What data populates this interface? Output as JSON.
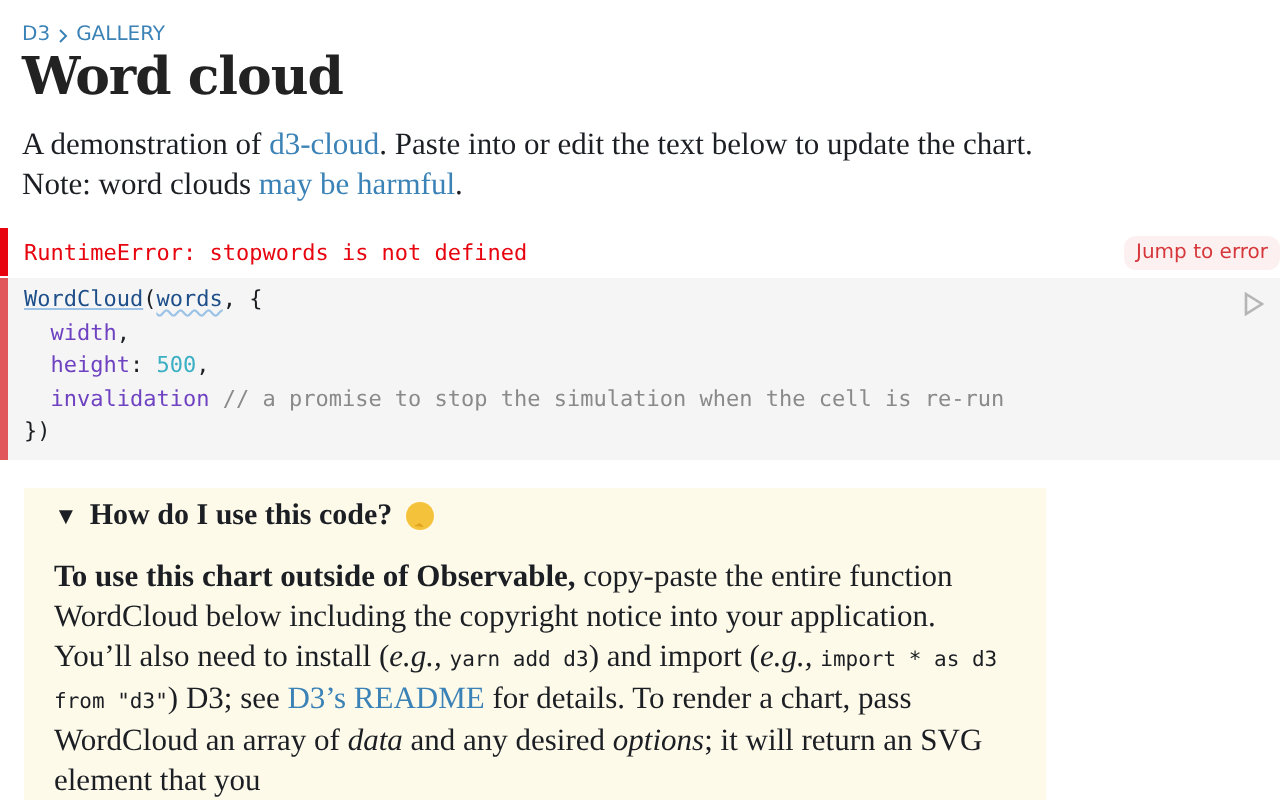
{
  "breadcrumb": [
    "D3",
    "GALLERY"
  ],
  "title": "Word cloud",
  "intro": [
    [
      {
        "kind": "text",
        "text": "A demonstration of "
      },
      {
        "kind": "link",
        "text": "d3-cloud"
      },
      {
        "kind": "text",
        "text": ". Paste into or edit the text below to update the chart."
      }
    ],
    [
      {
        "kind": "text",
        "text": "Note: word clouds "
      },
      {
        "kind": "link",
        "text": "may be harmful"
      },
      {
        "kind": "text",
        "text": "."
      }
    ]
  ],
  "error": {
    "message": "RuntimeError: stopwords is not defined",
    "jump_button": "Jump to error"
  },
  "code": [
    [
      {
        "kind": "fn",
        "text": "WordCloud"
      },
      {
        "kind": "plain",
        "text": "("
      },
      {
        "kind": "ref",
        "text": "words"
      },
      {
        "kind": "plain",
        "text": ", {"
      }
    ],
    [
      {
        "kind": "prop",
        "text": "  width"
      },
      {
        "kind": "plain",
        "text": ","
      }
    ],
    [
      {
        "kind": "prop",
        "text": "  height"
      },
      {
        "kind": "plain",
        "text": ": "
      },
      {
        "kind": "num",
        "text": "500"
      },
      {
        "kind": "plain",
        "text": ","
      }
    ],
    [
      {
        "kind": "prop",
        "text": "  invalidation"
      },
      {
        "kind": "comment",
        "text": " // a promise to stop the simulation when the cell is re-run"
      }
    ],
    [
      {
        "kind": "plain",
        "text": "})"
      }
    ]
  ],
  "details": {
    "expanded": true,
    "marker": "▼",
    "summary": "How do I use this code?",
    "paragraph": [
      {
        "kind": "bold",
        "text": "To use this chart outside of Observable,"
      },
      {
        "kind": "text",
        "text": " copy-paste the entire function WordCloud below including the copyright notice into your application. You’ll also need to install ("
      },
      {
        "kind": "text",
        "text": "*e.g.,* "
      },
      {
        "kind": "code",
        "text": "yarn add d3"
      },
      {
        "kind": "text",
        "text": ") and import ("
      },
      {
        "kind": "text",
        "text": "*e.g.,* "
      },
      {
        "kind": "code",
        "text": "import * as d3 from \"d3\""
      },
      {
        "kind": "text",
        "text": ") D3; see "
      },
      {
        "kind": "link",
        "text": "D3’s README"
      },
      {
        "kind": "text",
        "text": " for details. To render a chart, pass WordCloud an array of *data* and any desired *options*; it will return an SVG element that you"
      }
    ]
  }
}
